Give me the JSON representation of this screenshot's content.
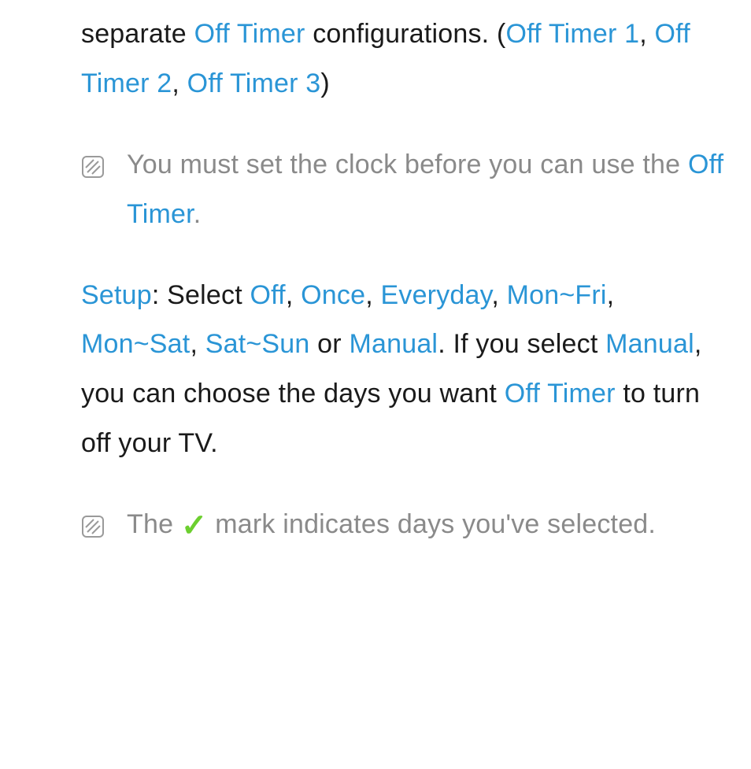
{
  "intro": {
    "t1": "separate ",
    "offtimer": "Off Timer",
    "t2": " configurations. (",
    "ot1": "Off Timer 1",
    "sep1": ", ",
    "ot2": "Off Timer 2",
    "sep2": ", ",
    "ot3": "Off Timer 3",
    "t3": ")"
  },
  "note1": {
    "t1": "You must set the clock before you can use the ",
    "offtimer": "Off Timer",
    "t2": "."
  },
  "setup": {
    "label": "Setup",
    "t1": ": Select ",
    "off": "Off",
    "sep1": ", ",
    "once": "Once",
    "sep2": ", ",
    "everyday": "Everyday",
    "sep3": ", ",
    "monfri": "Mon~Fri",
    "sep4": ", ",
    "monsat": "Mon~Sat",
    "sep5": ", ",
    "satsun": "Sat~Sun",
    "t2": " or ",
    "manual1": "Manual",
    "t3": ". If you select ",
    "manual2": "Manual",
    "t4": ", you can choose the days you want ",
    "offtimer": "Off Timer",
    "t5": " to turn off your TV."
  },
  "note2": {
    "t1": "The ",
    "check": "✓",
    "t2": " mark indicates days you've selected."
  }
}
